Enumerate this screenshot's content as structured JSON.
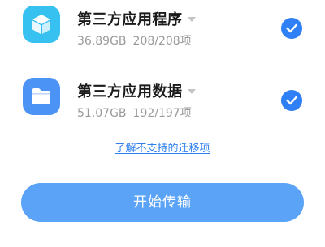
{
  "items": [
    {
      "title": "第三方应用程序",
      "size": "36.89GB",
      "count": "208/208项",
      "icon": "app-cube-icon",
      "checked": true
    },
    {
      "title": "第三方应用数据",
      "size": "51.07GB",
      "count": "192/197项",
      "icon": "folder-icon",
      "checked": true
    }
  ],
  "link": {
    "label": "了解不支持的迁移项"
  },
  "start_button": {
    "label": "开始传输"
  },
  "colors": {
    "accent": "#2f7ff5",
    "button": "#5aa3f7",
    "app_icon": "#36c1f0",
    "data_icon": "#4b93f5"
  }
}
